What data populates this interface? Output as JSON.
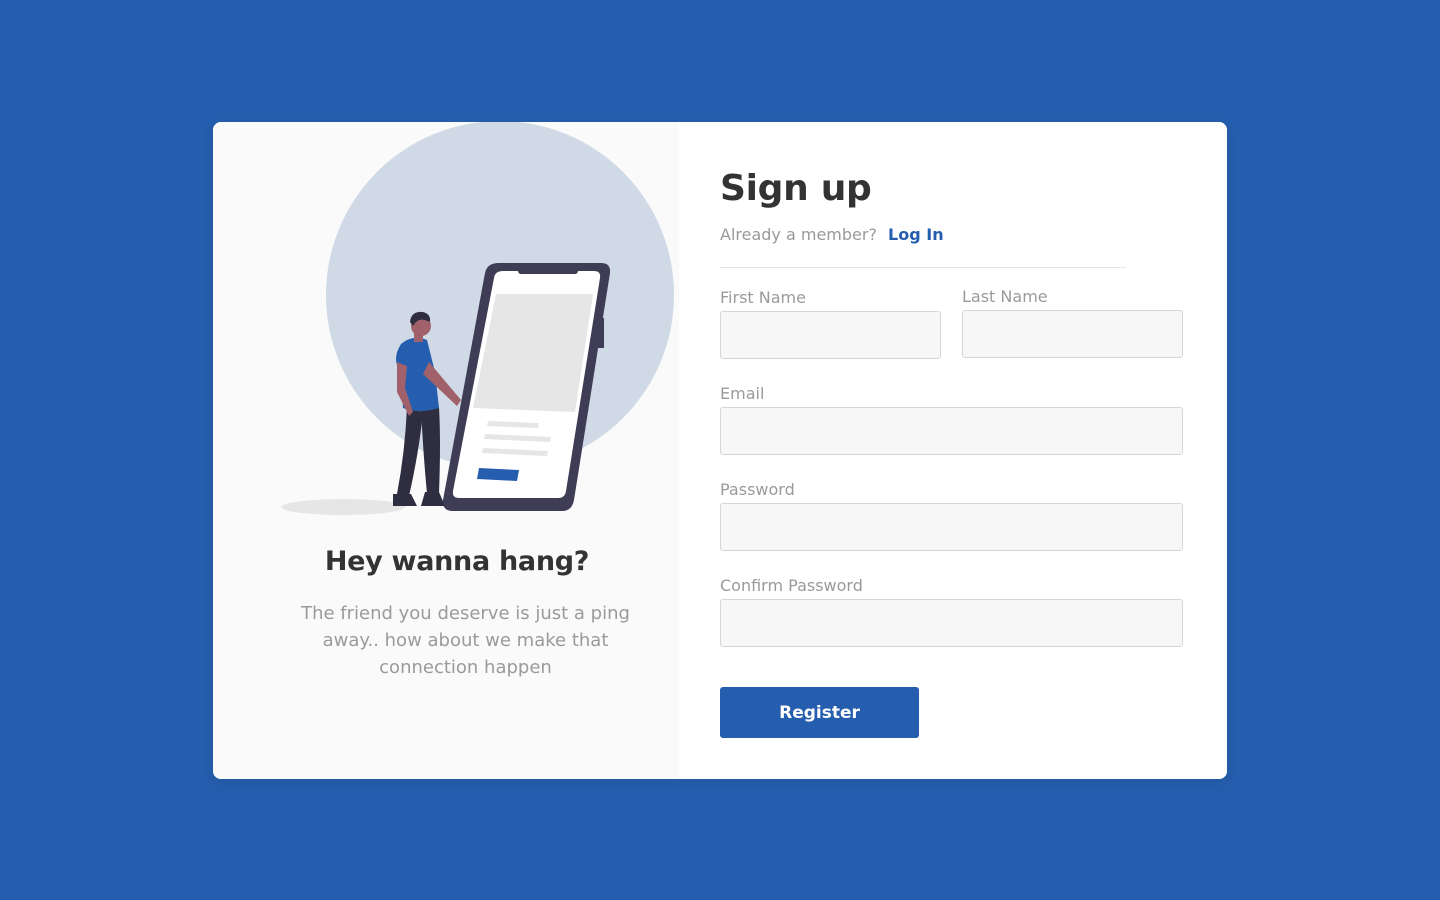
{
  "promo": {
    "heading": "Hey wanna hang?",
    "text": "The friend you deserve is just a ping away.. how about we make that connection happen"
  },
  "form": {
    "title": "Sign up",
    "member_prompt": "Already a member?",
    "login_label": "Log In",
    "fields": {
      "first_name": {
        "label": "First Name",
        "value": ""
      },
      "last_name": {
        "label": "Last Name",
        "value": ""
      },
      "email": {
        "label": "Email",
        "value": ""
      },
      "password": {
        "label": "Password",
        "value": ""
      },
      "confirm_password": {
        "label": "Confirm Password",
        "value": ""
      }
    },
    "register_label": "Register"
  },
  "colors": {
    "background": "#255eae",
    "accent": "#255eae",
    "card": "#ffffff",
    "left_panel": "#fafafa",
    "illustration_circle": "#d0d9e6",
    "heading_text": "#333333",
    "muted_text": "#9a9a9a"
  },
  "icons": {
    "illustration": "person-with-phone-illustration"
  }
}
